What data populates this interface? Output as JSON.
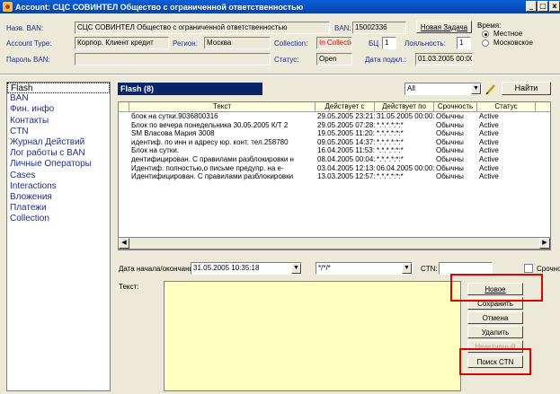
{
  "window": {
    "title": "Account: СЦС СОВИНТЕЛ Общество с ограниченной ответственностью",
    "minimize": "_",
    "maximize": "□",
    "close": "x"
  },
  "header": {
    "name_ban_label": "Назв. BAN:",
    "name_ban_value": "СЦС СОВИНТЕЛ Общество с ограниченной ответственностью",
    "ban_label": "BAN:",
    "ban_value": "15002336",
    "new_task_button": "Новая Задача",
    "time_label": "Время:",
    "time_local": "Местное",
    "time_moscow": "Московское",
    "account_type_label": "Account Type:",
    "account_type_value": "Корпор. Клиент кредит",
    "region_label": "Регион:",
    "region_value": "Москва",
    "collection_label": "Collection:",
    "collection_value": "In Collection",
    "bc_label": "БЦ",
    "bc_value": "1",
    "loyalty_label": "Лояльность:",
    "loyalty_value": "1",
    "password_label": "Пароль BAN:",
    "password_value": "",
    "status_label": "Статус:",
    "status_value": "Open",
    "connect_date_label": "Дата подкл.:",
    "connect_date_value": "01.03.2005 00:00"
  },
  "sidebar": {
    "items": [
      {
        "label": "Flash"
      },
      {
        "label": "BAN"
      },
      {
        "label": "Фин. инфо"
      },
      {
        "label": "Контакты"
      },
      {
        "label": "CTN"
      },
      {
        "label": "Журнал Действий"
      },
      {
        "label": "Лог работы с BAN"
      },
      {
        "label": "Личные Операторы"
      },
      {
        "label": "Cases"
      },
      {
        "label": "Interactions"
      },
      {
        "label": "Вложения"
      },
      {
        "label": "Платежи"
      },
      {
        "label": "Collection"
      }
    ]
  },
  "flash": {
    "title": "Flash (8)",
    "filter_value": "All",
    "find_button": "Найти",
    "pencil_icon": "pencil-icon",
    "columns": [
      "Текст",
      "Действует с",
      "Действует по",
      "Срочность",
      "Статус"
    ],
    "rows": [
      {
        "text": "блок на сутки.9036800316",
        "from": "29.05.2005 23:21:47",
        "to": "31.05.2005 00:00:00",
        "urgency": "Обычны",
        "status": "Active"
      },
      {
        "text": "Блок по вечера понедельника 30.05.2005 К/Т 2",
        "from": "29.05.2005 07:28:54",
        "to": "*.*.*.*:*:*",
        "urgency": "Обычны",
        "status": "Active"
      },
      {
        "text": "SM  Власова Мария 3008",
        "from": "19.05.2005 11:20:06",
        "to": "*.*.*.*:*:*",
        "urgency": "Обычны",
        "status": "Active"
      },
      {
        "text": "идентиф. по инн и адресу юр. конт. тел.258780",
        "from": "09.05.2005 14:37:06",
        "to": "*.*.*.*:*:*",
        "urgency": "Обычны",
        "status": "Active"
      },
      {
        "text": "Блок на сутки.",
        "from": "16.04.2005 11:53:03",
        "to": "*.*.*.*:*:*",
        "urgency": "Обычны",
        "status": "Active"
      },
      {
        "text": "дентифицирован. С правилами разблокировки н",
        "from": "08.04.2005 00:04:17",
        "to": "*.*.*.*:*:*",
        "urgency": "Обычны",
        "status": "Active"
      },
      {
        "text": "Идентиф. полностью,о письме предупр. на е-",
        "from": "03.04.2005 12:13:09",
        "to": "06.04.2005 00:00:00",
        "urgency": "Обычны",
        "status": "Active"
      },
      {
        "text": "Идентифицирован. С правилами разблокировки",
        "from": "13.03.2005 12:57:59",
        "to": "*.*.*.*:*:*",
        "urgency": "Обычны",
        "status": "Active"
      }
    ]
  },
  "editor": {
    "date_label": "Дата начала/окончания:",
    "date_from": "31.05.2005 10:35:18",
    "date_to": "*/*/*",
    "ctn_label": "CTN:",
    "ctn_value": "",
    "urgent_label": "Срочно",
    "text_label": "Текст:",
    "buttons": {
      "new": "Новое",
      "save": "Сохранить",
      "cancel": "Отмена",
      "delete": "Удалить",
      "inactive": "Неактивный",
      "search_ctn": "Поиск CTN"
    }
  },
  "colors": {
    "title_bar": "#0a5fd8",
    "panel_title": "#0a246a",
    "highlight": "#e00000",
    "text_area": "#ffffc0"
  }
}
